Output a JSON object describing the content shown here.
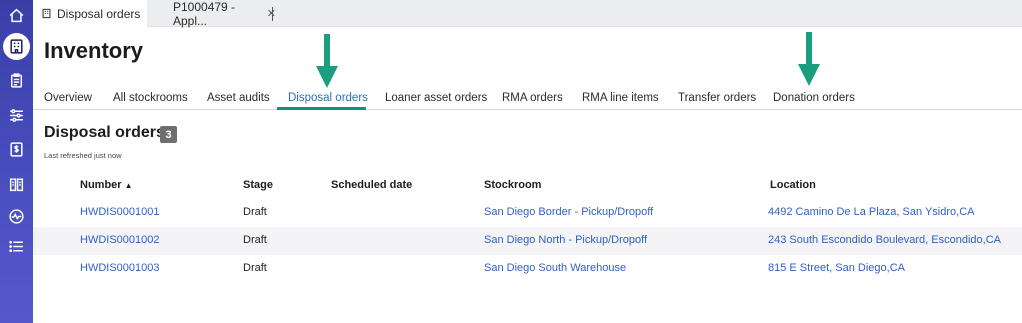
{
  "tabs": [
    {
      "label": "Disposal orders"
    },
    {
      "label": "P1000479 - Appl..."
    }
  ],
  "page": {
    "title": "Inventory"
  },
  "subnav": [
    "Overview",
    "All stockrooms",
    "Asset audits",
    "Disposal orders",
    "Loaner asset orders",
    "RMA orders",
    "RMA line items",
    "Transfer orders",
    "Donation orders"
  ],
  "list": {
    "title": "Disposal orders",
    "count": "3",
    "refreshed": "Last refreshed just now"
  },
  "columns": [
    "Number",
    "Stage",
    "Scheduled date",
    "Stockroom",
    "Location"
  ],
  "rows": [
    {
      "number": "HWDIS0001001",
      "stage": "Draft",
      "scheduled": "",
      "stockroom": "San Diego Border - Pickup/Dropoff",
      "location": "4492 Camino De La Plaza, San Ysidro,CA"
    },
    {
      "number": "HWDIS0001002",
      "stage": "Draft",
      "scheduled": "",
      "stockroom": "San Diego North - Pickup/Dropoff",
      "location": "243 South Escondido Boulevard, Escondido,CA"
    },
    {
      "number": "HWDIS0001003",
      "stage": "Draft",
      "scheduled": "",
      "stockroom": "San Diego South Warehouse",
      "location": "815 E Street, San Diego,CA"
    }
  ],
  "colors": {
    "rail": "#4046b4",
    "accent": "#1a8e78",
    "link": "#2f5fc6",
    "arrow": "#1a9e7e"
  },
  "icons": [
    "home-icon",
    "building-icon",
    "clipboard-icon",
    "sliders-icon",
    "invoice-icon",
    "book-icon",
    "activity-icon",
    "list-icon",
    "sort-ascending-icon",
    "close-icon"
  ]
}
